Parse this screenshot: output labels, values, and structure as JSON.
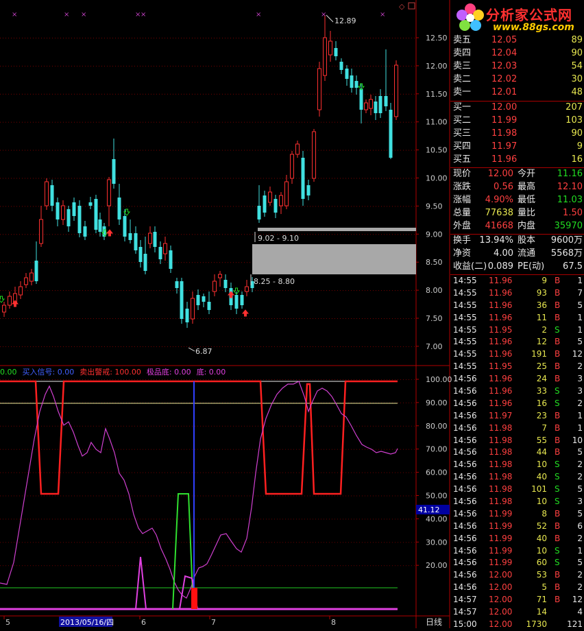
{
  "logo": {
    "name": "分析家公式网",
    "url": "www.88gs.com"
  },
  "main_chart": {
    "price_ticks": [
      "12.50",
      "12.00",
      "11.50",
      "11.00",
      "10.50",
      "10.00",
      "9.50",
      "9.00",
      "8.50",
      "8.00",
      "7.50",
      "7.00"
    ],
    "high_label": "12.89",
    "low_label": "6.87",
    "zone_label_top": "9.02 - 9.10",
    "zone_label_bottom": "8.25 - 8.80"
  },
  "indicator": {
    "legend": [
      {
        "text": "0.00",
        "color": "#22dd22"
      },
      {
        "text": "买入信号: 0.00",
        "color": "#4060ff"
      },
      {
        "text": "卖出警戒: 100.00",
        "color": "#ff3030"
      },
      {
        "text": "极品底: 0.00",
        "color": "#e040e0"
      },
      {
        "text": "底: 0.00",
        "color": "#e040e0"
      }
    ],
    "ticks": [
      "100.00",
      "90.00",
      "80.00",
      "70.00",
      "60.00",
      "50.00",
      "40.00",
      "30.00",
      "20.00"
    ],
    "current_value": "41.12"
  },
  "date_axis": {
    "labels": [
      "5",
      "6",
      "7",
      "8"
    ],
    "selected_date": "2013/05/16/四",
    "period": "日线"
  },
  "order_book": {
    "asks": [
      {
        "label": "卖五",
        "price": "12.05",
        "vol": "89"
      },
      {
        "label": "卖四",
        "price": "12.04",
        "vol": "90"
      },
      {
        "label": "卖三",
        "price": "12.03",
        "vol": "54"
      },
      {
        "label": "卖二",
        "price": "12.02",
        "vol": "30"
      },
      {
        "label": "卖一",
        "price": "12.01",
        "vol": "48"
      }
    ],
    "bids": [
      {
        "label": "买一",
        "price": "12.00",
        "vol": "207"
      },
      {
        "label": "买二",
        "price": "11.99",
        "vol": "103"
      },
      {
        "label": "买三",
        "price": "11.98",
        "vol": "90"
      },
      {
        "label": "买四",
        "price": "11.97",
        "vol": "9"
      },
      {
        "label": "买五",
        "price": "11.96",
        "vol": "16"
      }
    ]
  },
  "quote": [
    {
      "l1": "现价",
      "v1": "12.00",
      "c1": "red",
      "l2": "今开",
      "v2": "11.16",
      "c2": "green"
    },
    {
      "l1": "涨跌",
      "v1": "0.56",
      "c1": "red",
      "l2": "最高",
      "v2": "12.10",
      "c2": "red"
    },
    {
      "l1": "涨幅",
      "v1": "4.90%",
      "c1": "red",
      "l2": "最低",
      "v2": "11.03",
      "c2": "green"
    },
    {
      "l1": "总量",
      "v1": "77638",
      "c1": "yellow",
      "l2": "量比",
      "v2": "1.50",
      "c2": "red"
    },
    {
      "l1": "外盘",
      "v1": "41668",
      "c1": "red",
      "l2": "内盘",
      "v2": "35970",
      "c2": "green"
    }
  ],
  "stats": [
    {
      "l1": "换手",
      "v1": "13.94%",
      "l2": "股本",
      "v2": "9600万"
    },
    {
      "l1": "净资",
      "v1": "4.00",
      "l2": "流通",
      "v2": "5568万"
    },
    {
      "l1": "收益(二)",
      "v1": "0.089",
      "l2": "PE(动)",
      "v2": "67.5"
    }
  ],
  "ticks": [
    {
      "t": "14:55",
      "p": "11.96",
      "v": "9",
      "bs": "B",
      "n": "1"
    },
    {
      "t": "14:55",
      "p": "11.96",
      "v": "93",
      "bs": "B",
      "n": "7"
    },
    {
      "t": "14:55",
      "p": "11.96",
      "v": "36",
      "bs": "B",
      "n": "5"
    },
    {
      "t": "14:55",
      "p": "11.96",
      "v": "11",
      "bs": "B",
      "n": "1"
    },
    {
      "t": "14:55",
      "p": "11.95",
      "v": "2",
      "bs": "S",
      "n": "1"
    },
    {
      "t": "14:55",
      "p": "11.96",
      "v": "12",
      "bs": "B",
      "n": "5"
    },
    {
      "t": "14:55",
      "p": "11.96",
      "v": "191",
      "bs": "B",
      "n": "12"
    },
    {
      "t": "14:55",
      "p": "11.95",
      "v": "25",
      "bs": "B",
      "n": "2"
    },
    {
      "t": "14:56",
      "p": "11.96",
      "v": "24",
      "bs": "B",
      "n": "3"
    },
    {
      "t": "14:56",
      "p": "11.96",
      "v": "33",
      "bs": "S",
      "n": "3"
    },
    {
      "t": "14:56",
      "p": "11.96",
      "v": "16",
      "bs": "S",
      "n": "2"
    },
    {
      "t": "14:56",
      "p": "11.97",
      "v": "23",
      "bs": "B",
      "n": "1"
    },
    {
      "t": "14:56",
      "p": "11.98",
      "v": "7",
      "bs": "B",
      "n": "1"
    },
    {
      "t": "14:56",
      "p": "11.98",
      "v": "55",
      "bs": "B",
      "n": "10"
    },
    {
      "t": "14:56",
      "p": "11.98",
      "v": "44",
      "bs": "B",
      "n": "5"
    },
    {
      "t": "14:56",
      "p": "11.98",
      "v": "10",
      "bs": "S",
      "n": "2"
    },
    {
      "t": "14:56",
      "p": "11.98",
      "v": "40",
      "bs": "S",
      "n": "2"
    },
    {
      "t": "14:56",
      "p": "11.98",
      "v": "101",
      "bs": "S",
      "n": "5"
    },
    {
      "t": "14:56",
      "p": "11.98",
      "v": "10",
      "bs": "S",
      "n": "3"
    },
    {
      "t": "14:56",
      "p": "11.99",
      "v": "8",
      "bs": "B",
      "n": "5"
    },
    {
      "t": "14:56",
      "p": "11.99",
      "v": "52",
      "bs": "B",
      "n": "6"
    },
    {
      "t": "14:56",
      "p": "11.99",
      "v": "40",
      "bs": "B",
      "n": "2"
    },
    {
      "t": "14:56",
      "p": "11.99",
      "v": "10",
      "bs": "S",
      "n": "1"
    },
    {
      "t": "14:56",
      "p": "11.99",
      "v": "60",
      "bs": "S",
      "n": "5"
    },
    {
      "t": "14:56",
      "p": "12.00",
      "v": "53",
      "bs": "B",
      "n": "2"
    },
    {
      "t": "14:56",
      "p": "12.00",
      "v": "5",
      "bs": "B",
      "n": "2"
    },
    {
      "t": "14:57",
      "p": "12.00",
      "v": "71",
      "bs": "B",
      "n": "12"
    },
    {
      "t": "14:57",
      "p": "12.00",
      "v": "14",
      "bs": "",
      "n": "4"
    },
    {
      "t": "15:00",
      "p": "12.00",
      "v": "1730",
      "bs": "",
      "n": "121"
    }
  ]
}
